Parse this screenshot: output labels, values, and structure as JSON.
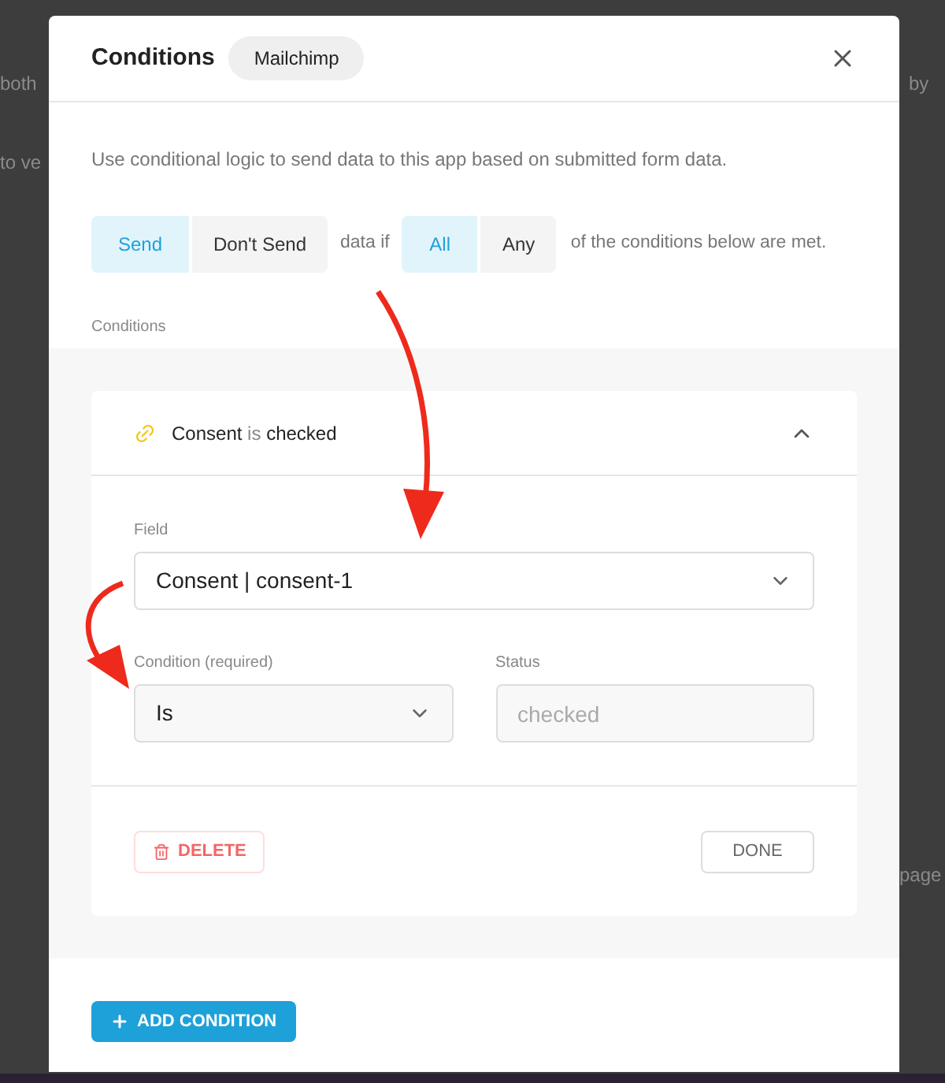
{
  "background_fragments": [
    {
      "text": "both"
    },
    {
      "text": "by"
    },
    {
      "text": "to ve"
    },
    {
      "text": "page"
    }
  ],
  "modal": {
    "title": "Conditions",
    "badge": "Mailchimp",
    "description": "Use conditional logic to send data to this app based on submitted form data.",
    "action_options": [
      {
        "label": "Send",
        "selected": true
      },
      {
        "label": "Don't Send",
        "selected": false
      }
    ],
    "connector_text": "data if",
    "match_options": [
      {
        "label": "All",
        "selected": true
      },
      {
        "label": "Any",
        "selected": false
      }
    ],
    "trailing_text": "of the conditions below are met.",
    "conditions_label": "Conditions",
    "condition": {
      "expanded": true,
      "summary_field": "Consent",
      "summary_operator": "is",
      "summary_value": "checked",
      "field_label": "Field",
      "field_value": "Consent | consent-1",
      "condition_label": "Condition (required)",
      "condition_value": "Is",
      "status_label": "Status",
      "status_placeholder": "checked",
      "delete_label": "DELETE",
      "done_label": "DONE"
    },
    "add_button": "ADD CONDITION"
  }
}
